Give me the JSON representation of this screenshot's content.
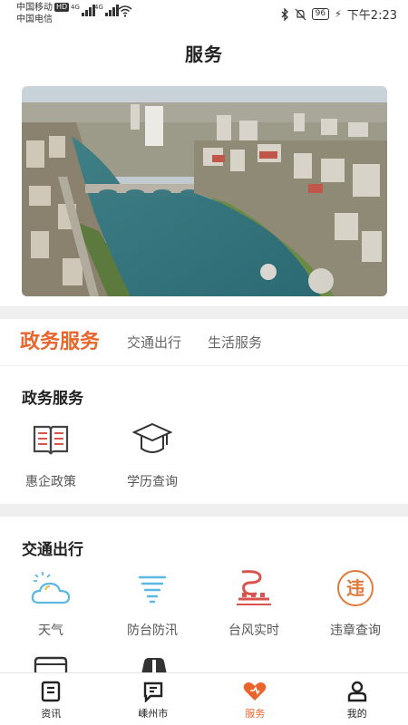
{
  "status_bar": {
    "carrier1": "中国移动",
    "hd": "HD",
    "carrier2": "中国电信",
    "net1": "4G",
    "net2": "4G",
    "battery": "96",
    "time": "下午2:23"
  },
  "header": {
    "title": "服务"
  },
  "banner": {
    "icon": "city-river-photo"
  },
  "tabs": [
    {
      "label": "政务服务",
      "active": true
    },
    {
      "label": "交通出行",
      "active": false
    },
    {
      "label": "生活服务",
      "active": false
    }
  ],
  "gov_section": {
    "title": "政务服务",
    "items": [
      {
        "label": "惠企政策",
        "icon": "book-icon"
      },
      {
        "label": "学历查询",
        "icon": "graduation-cap-icon"
      }
    ]
  },
  "traffic_section": {
    "title": "交通出行",
    "items": [
      {
        "label": "天气",
        "icon": "weather-cloud-icon"
      },
      {
        "label": "防台防汛",
        "icon": "flood-icon"
      },
      {
        "label": "台风实时",
        "icon": "typhoon-icon"
      },
      {
        "label": "违章查询",
        "icon": "violation-icon"
      }
    ],
    "violation_char": "违"
  },
  "bottom_nav": [
    {
      "label": "资讯",
      "icon": "news-icon",
      "active": false
    },
    {
      "label": "嵊州市",
      "icon": "city-chat-icon",
      "active": false
    },
    {
      "label": "服务",
      "icon": "heart-service-icon",
      "active": true
    },
    {
      "label": "我的",
      "icon": "user-icon",
      "active": false
    }
  ],
  "colors": {
    "accent": "#e8662c",
    "icon_red": "#d9534f",
    "icon_blue": "#5bb8e0"
  }
}
